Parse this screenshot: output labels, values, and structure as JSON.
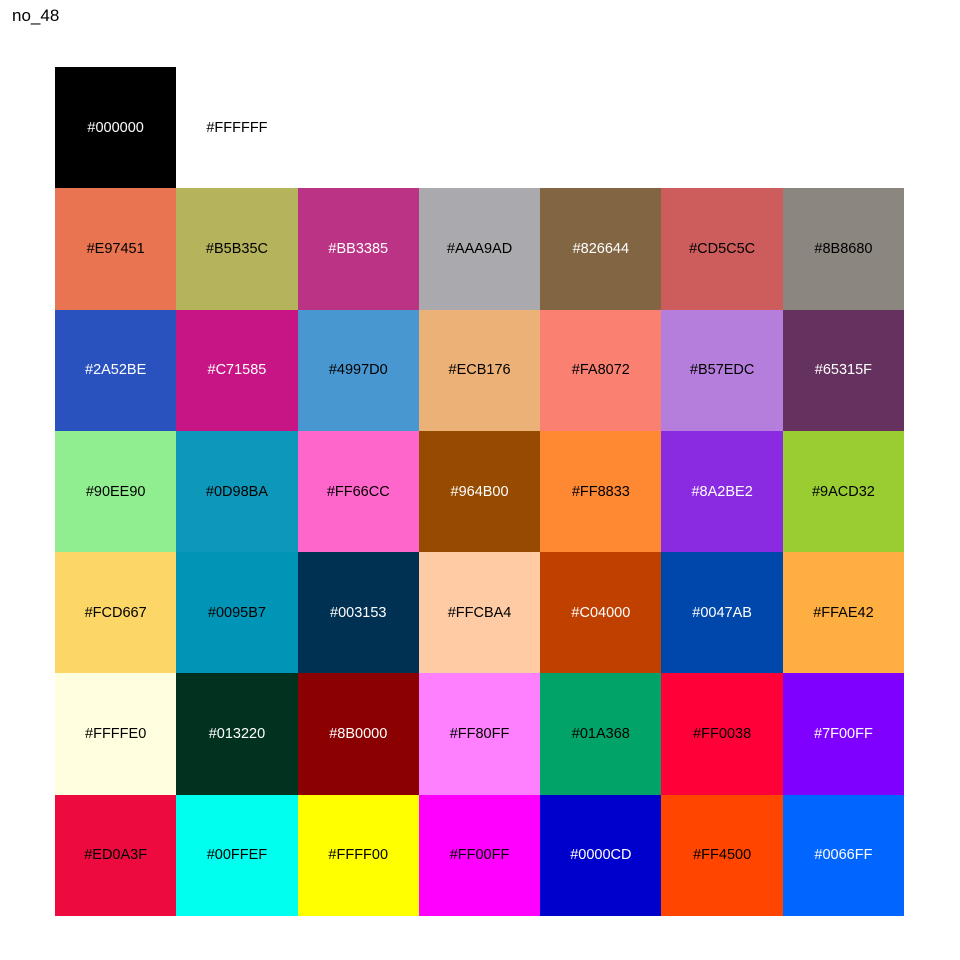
{
  "title": "no_48",
  "swatches": [
    {
      "hex": "#000000",
      "text_color": "#FFFFFF"
    },
    {
      "hex": "#FFFFFF",
      "text_color": "#000000"
    },
    {
      "hex": "#E97451",
      "text_color": "#000000"
    },
    {
      "hex": "#B5B35C",
      "text_color": "#000000"
    },
    {
      "hex": "#BB3385",
      "text_color": "#FFFFFF"
    },
    {
      "hex": "#AAA9AD",
      "text_color": "#000000"
    },
    {
      "hex": "#826644",
      "text_color": "#FFFFFF"
    },
    {
      "hex": "#CD5C5C",
      "text_color": "#000000"
    },
    {
      "hex": "#8B8680",
      "text_color": "#000000"
    },
    {
      "hex": "#2A52BE",
      "text_color": "#FFFFFF"
    },
    {
      "hex": "#C71585",
      "text_color": "#FFFFFF"
    },
    {
      "hex": "#4997D0",
      "text_color": "#000000"
    },
    {
      "hex": "#ECB176",
      "text_color": "#000000"
    },
    {
      "hex": "#FA8072",
      "text_color": "#000000"
    },
    {
      "hex": "#B57EDC",
      "text_color": "#000000"
    },
    {
      "hex": "#65315F",
      "text_color": "#FFFFFF"
    },
    {
      "hex": "#90EE90",
      "text_color": "#000000"
    },
    {
      "hex": "#0D98BA",
      "text_color": "#000000"
    },
    {
      "hex": "#FF66CC",
      "text_color": "#000000"
    },
    {
      "hex": "#964B00",
      "text_color": "#FFFFFF"
    },
    {
      "hex": "#FF8833",
      "text_color": "#000000"
    },
    {
      "hex": "#8A2BE2",
      "text_color": "#FFFFFF"
    },
    {
      "hex": "#9ACD32",
      "text_color": "#000000"
    },
    {
      "hex": "#FCD667",
      "text_color": "#000000"
    },
    {
      "hex": "#0095B7",
      "text_color": "#000000"
    },
    {
      "hex": "#003153",
      "text_color": "#FFFFFF"
    },
    {
      "hex": "#FFCBA4",
      "text_color": "#000000"
    },
    {
      "hex": "#C04000",
      "text_color": "#FFFFFF"
    },
    {
      "hex": "#0047AB",
      "text_color": "#FFFFFF"
    },
    {
      "hex": "#FFAE42",
      "text_color": "#000000"
    },
    {
      "hex": "#FFFFE0",
      "text_color": "#000000"
    },
    {
      "hex": "#013220",
      "text_color": "#FFFFFF"
    },
    {
      "hex": "#8B0000",
      "text_color": "#FFFFFF"
    },
    {
      "hex": "#FF80FF",
      "text_color": "#000000"
    },
    {
      "hex": "#01A368",
      "text_color": "#000000"
    },
    {
      "hex": "#FF0038",
      "text_color": "#000000"
    },
    {
      "hex": "#7F00FF",
      "text_color": "#FFFFFF"
    },
    {
      "hex": "#ED0A3F",
      "text_color": "#000000"
    },
    {
      "hex": "#00FFEF",
      "text_color": "#000000"
    },
    {
      "hex": "#FFFF00",
      "text_color": "#000000"
    },
    {
      "hex": "#FF00FF",
      "text_color": "#000000"
    },
    {
      "hex": "#0000CD",
      "text_color": "#FFFFFF"
    },
    {
      "hex": "#FF4500",
      "text_color": "#000000"
    },
    {
      "hex": "#0066FF",
      "text_color": "#FFFFFF"
    }
  ]
}
